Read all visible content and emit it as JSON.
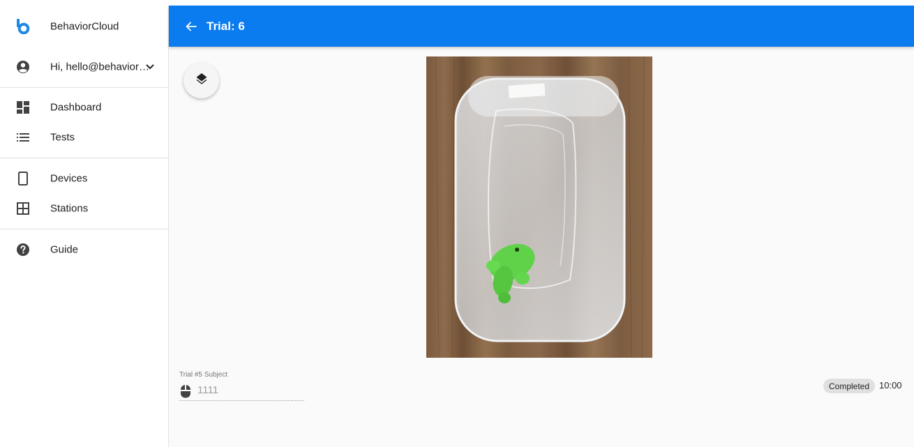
{
  "app": {
    "name": "BehaviorCloud",
    "brand_color": "#0a7cf0"
  },
  "user": {
    "greeting": "Hi, hello@behavior…"
  },
  "sidebar": {
    "items": [
      {
        "label": "Dashboard",
        "icon": "dashboard-icon"
      },
      {
        "label": "Tests",
        "icon": "list-icon"
      },
      {
        "label": "Devices",
        "icon": "tablet-icon"
      },
      {
        "label": "Stations",
        "icon": "grid-icon"
      },
      {
        "label": "Guide",
        "icon": "help-icon"
      }
    ]
  },
  "header": {
    "title": "Trial: 6"
  },
  "subject": {
    "label": "Trial #5 Subject",
    "value": "1111"
  },
  "status": {
    "label": "Completed",
    "duration": "10:00"
  }
}
